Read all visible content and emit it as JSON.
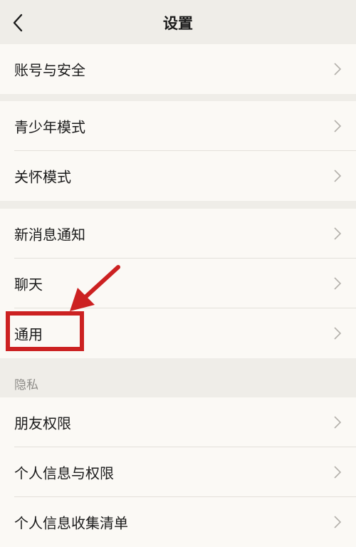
{
  "header": {
    "title": "设置",
    "back_icon": "chevron-left-icon"
  },
  "groups": [
    {
      "items": [
        {
          "label": "账号与安全"
        }
      ]
    },
    {
      "items": [
        {
          "label": "青少年模式"
        },
        {
          "label": "关怀模式"
        }
      ]
    },
    {
      "items": [
        {
          "label": "新消息通知"
        },
        {
          "label": "聊天"
        },
        {
          "label": "通用"
        }
      ]
    },
    {
      "section_label": "隐私",
      "items": [
        {
          "label": "朋友权限"
        },
        {
          "label": "个人信息与权限"
        },
        {
          "label": "个人信息收集清单"
        }
      ]
    }
  ],
  "annotation": {
    "color": "#cc2121",
    "target": "通用"
  },
  "colors": {
    "background": "#efede8",
    "card": "#fbf9f5",
    "accent": "#cc2121"
  }
}
